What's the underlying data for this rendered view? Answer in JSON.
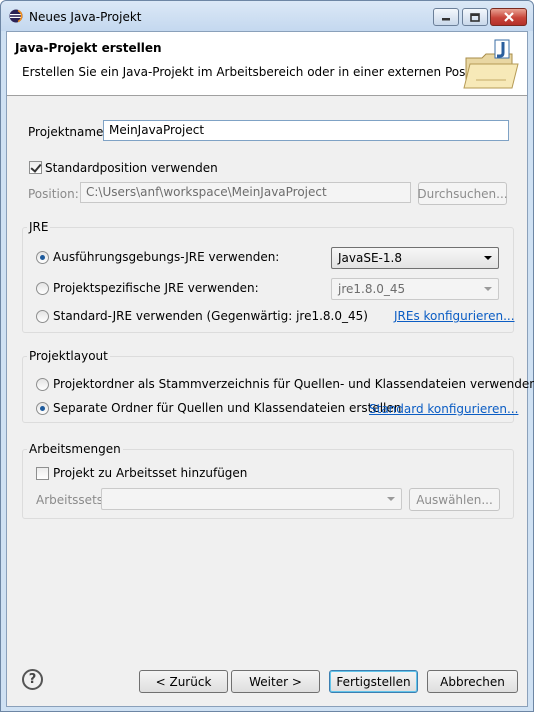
{
  "window": {
    "title": "Neues Java-Projekt"
  },
  "banner": {
    "title": "Java-Projekt erstellen",
    "description": "Erstellen Sie ein Java-Projekt im Arbeitsbereich oder in einer externen Position."
  },
  "project": {
    "name_label": "Projektname:",
    "name_value": "MeinJavaProject",
    "default_location_label": "Standardposition verwenden",
    "default_location_checked": true,
    "location_label": "Position:",
    "location_value": "C:\\Users\\anf\\workspace\\MeinJavaProject",
    "browse_label": "Durchsuchen..."
  },
  "jre": {
    "group_title": "JRE",
    "option_env_label": "Ausführungsgebungs-JRE verwenden:",
    "option_env_value": "JavaSE-1.8",
    "option_project_label": "Projektspezifische JRE verwenden:",
    "option_project_value": "jre1.8.0_45",
    "option_default_label": "Standard-JRE verwenden (Gegenwärtig: jre1.8.0_45)",
    "configure_link": "JREs konfigurieren...",
    "selected": "env"
  },
  "layout": {
    "group_title": "Projektlayout",
    "option_root_label": "Projektordner als Stammverzeichnis für Quellen- und Klassendateien verwenden",
    "option_separate_label": "Separate Ordner für Quellen und Klassendateien erstellen",
    "configure_link": "Standard konfigurieren...",
    "selected": "separate"
  },
  "working_sets": {
    "group_title": "Arbeitsmengen",
    "add_label": "Projekt zu Arbeitsset hinzufügen",
    "add_checked": false,
    "sets_label": "Arbeitssets:",
    "sets_value": "",
    "select_label": "Auswählen..."
  },
  "footer": {
    "help_glyph": "?",
    "back_label": "< Zurück",
    "next_label": "Weiter >",
    "finish_label": "Fertigstellen",
    "cancel_label": "Abbrechen"
  },
  "colors": {
    "link": "#0b5dc4",
    "title_bar": "#c4d8ef",
    "close_button": "#c8453a"
  }
}
